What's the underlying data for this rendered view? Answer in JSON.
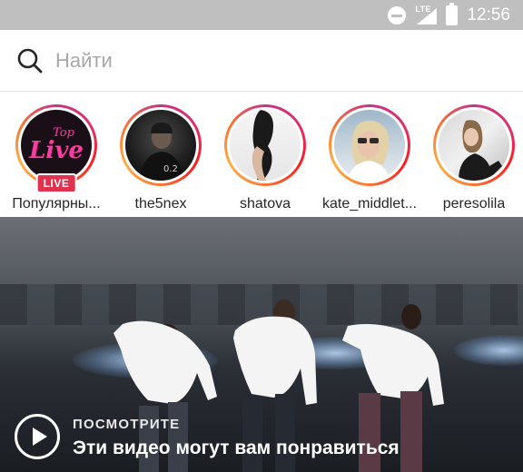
{
  "status_bar": {
    "network": "LTE",
    "time": "12:56",
    "icons": [
      "do-not-disturb-icon",
      "signal-icon",
      "battery-icon"
    ]
  },
  "search": {
    "placeholder": "Найти",
    "value": ""
  },
  "stories": {
    "items": [
      {
        "label": "Популярны...",
        "badge": "LIVE",
        "avatar_text_top": "Top",
        "avatar_text_big": "Live"
      },
      {
        "label": "the5nex"
      },
      {
        "label": "shatova"
      },
      {
        "label": "kate_middlet..."
      },
      {
        "label": "peresolila"
      }
    ]
  },
  "video": {
    "kicker": "ПОСМОТРИТЕ",
    "title": "Эти видео могут вам понравиться"
  },
  "colors": {
    "status_bar": "#bfbfbf",
    "live_badge": "#e0314f",
    "story_ring": "#c13584",
    "text": "#262626",
    "placeholder": "#a8a8a8"
  }
}
